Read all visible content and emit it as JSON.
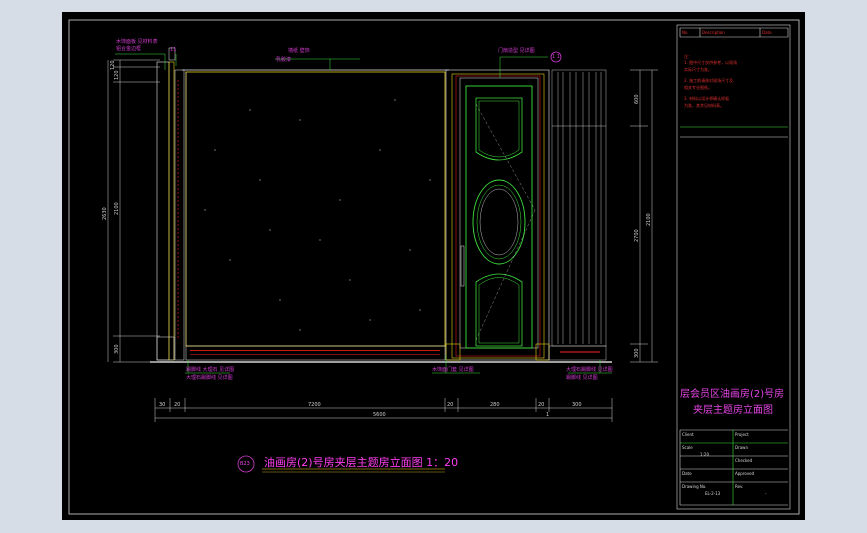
{
  "drawing": {
    "title": "油画房(2)号房夹层主题房立面图 1：20",
    "section_mark": "B23",
    "top_notes": {
      "note_a": "木饰面板  见材料表",
      "note_b": "铝合金边框",
      "note_c": "墙纸 壁饰",
      "note_d": "乳胶漆",
      "note_e": "门扇造型 见详图",
      "note_f": "11",
      "note_g": "木饰面 清漆",
      "note_h": "1 1"
    },
    "bottom_notes": {
      "left": "踢脚线 大理石 见详图",
      "left2": "大理石踢脚线 见详图",
      "mid": "木饰面门套 见详图",
      "right": "大理石踢脚线 见详图",
      "right2": "踢脚线 见详图"
    },
    "left_dims": {
      "a": "120",
      "b": "120",
      "c": "2630",
      "d": "2100",
      "e": "300"
    },
    "right_dims": {
      "a": "600",
      "b": "2700",
      "c": "2100",
      "d": "300"
    },
    "bottom_dims": {
      "a": "30",
      "b": "20",
      "c": "7200",
      "d": "20",
      "e": "280",
      "f": "20",
      "g": "300",
      "h": "5600",
      "i": "1"
    }
  },
  "title_block": {
    "head_col1": "No.",
    "head_col2": "Description",
    "head_col3": "Date",
    "notes_label": "注：",
    "notes": [
      "1. 图中尺寸仅供参考，以现场",
      "   实际尺寸为准。",
      "2. 施工前请核对现场尺寸及",
      "   相关专业图纸。",
      "3. 材料以设计师确认样板",
      "   为准，其余见材料表。"
    ],
    "project_line1": "层会员区油画房(2)号房",
    "project_line2": "夹层主题房立面图",
    "rows": [
      {
        "label": "Client",
        "value": "Project"
      },
      {
        "label": "Scale",
        "value": "Drawn"
      },
      {
        "label": "1:20",
        "value": "Checked"
      },
      {
        "label": "Date",
        "value": "Approved"
      },
      {
        "label": "Drawing No.",
        "value": "Rev."
      }
    ],
    "drawing_no": "EL-2-13",
    "rev": "-"
  },
  "colors": {
    "canvas": "#000000",
    "bg": "#d6dde6",
    "dim": "#cfd0d0",
    "note": "#d23cd2",
    "green": "#3ee33e",
    "red": "#ff2020",
    "yellow": "#e8d21a",
    "title": "#ff3ef0"
  }
}
